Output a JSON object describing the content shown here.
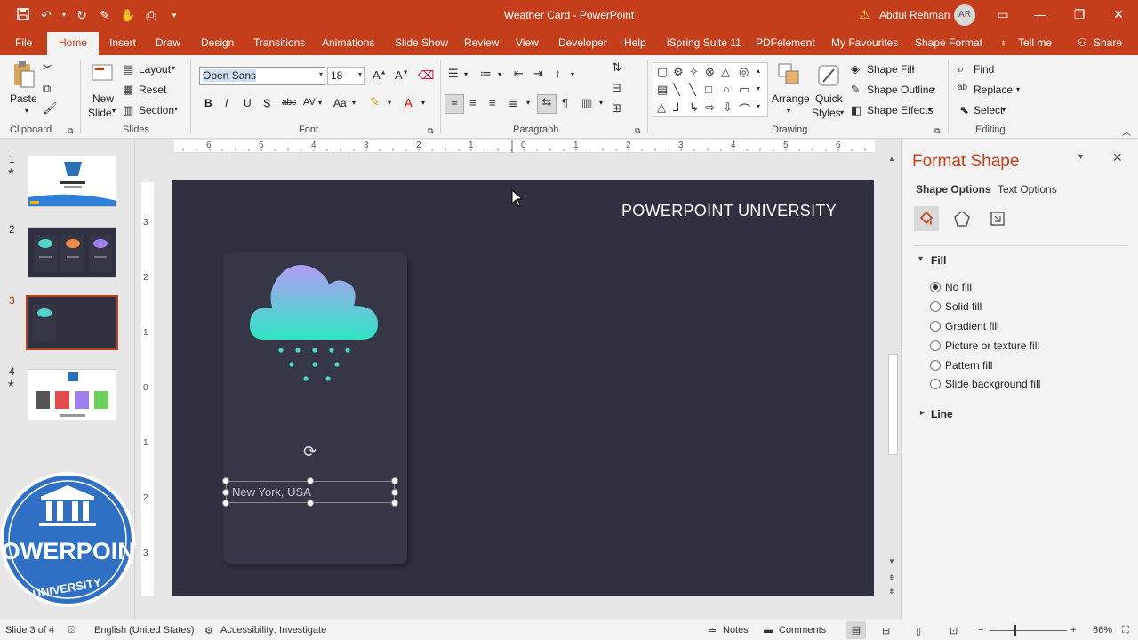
{
  "window": {
    "title": "Weather Card - PowerPoint",
    "user": "Abdul Rehman",
    "user_initials": "AR"
  },
  "tabs": [
    "File",
    "Home",
    "Insert",
    "Draw",
    "Design",
    "Transitions",
    "Animations",
    "Slide Show",
    "Review",
    "View",
    "Developer",
    "Help",
    "iSpring Suite 11",
    "PDFelement",
    "My Favourites",
    "Shape Format",
    "Tell me",
    "Share"
  ],
  "ribbon": {
    "clipboard": {
      "paste": "Paste",
      "label": "Clipboard"
    },
    "slides": {
      "new_slide_1": "New",
      "new_slide_2": "Slide",
      "layout": "Layout",
      "reset": "Reset",
      "section": "Section",
      "label": "Slides"
    },
    "font": {
      "name": "Open Sans",
      "size": "18",
      "label": "Font",
      "bold": "B",
      "italic": "I",
      "underline": "U",
      "shadow": "S",
      "strike": "abc",
      "spacing": "AV",
      "case": "Aa",
      "color": "A"
    },
    "paragraph": {
      "label": "Paragraph"
    },
    "drawing": {
      "arrange": "Arrange",
      "quick_1": "Quick",
      "quick_2": "Styles",
      "shape_fill": "Shape Fill",
      "shape_outline": "Shape Outline",
      "shape_effects": "Shape Effects",
      "label": "Drawing"
    },
    "editing": {
      "find": "Find",
      "replace": "Replace",
      "select": "Select",
      "label": "Editing"
    }
  },
  "slides": [
    {
      "num": "1",
      "star": "★"
    },
    {
      "num": "2",
      "star": ""
    },
    {
      "num": "3",
      "star": ""
    },
    {
      "num": "4",
      "star": "★"
    }
  ],
  "slide": {
    "heading": "POWERPOINT UNIVERSITY",
    "city": "New York, USA"
  },
  "logo": {
    "line1": "POWERPOINT",
    "line2": "UNIVERSITY"
  },
  "ruler": {
    "h": [
      "6",
      "5",
      "4",
      "3",
      "2",
      "1",
      "0",
      "1",
      "2",
      "3",
      "4",
      "5",
      "6"
    ],
    "v": [
      "3",
      "2",
      "1",
      "0",
      "1",
      "2",
      "3"
    ]
  },
  "pane": {
    "title": "Format Shape",
    "tab_shape": "Shape Options",
    "tab_text": "Text Options",
    "fill_header": "Fill",
    "line_header": "Line",
    "fill_options": [
      "No fill",
      "Solid fill",
      "Gradient fill",
      "Picture or texture fill",
      "Pattern fill",
      "Slide background fill"
    ],
    "selected_fill": "No fill"
  },
  "status": {
    "slide": "Slide 3 of 4",
    "language": "English (United States)",
    "accessibility": "Accessibility: Investigate",
    "notes": "Notes",
    "comments": "Comments",
    "zoom": "66%"
  },
  "colors": {
    "accent": "#c43e1c",
    "slide_bg": "#303140",
    "card_bg": "#353646",
    "cloud_top": "#b39bf5",
    "cloud_bottom": "#2ee6c5",
    "drops": "#4fd6c9"
  }
}
